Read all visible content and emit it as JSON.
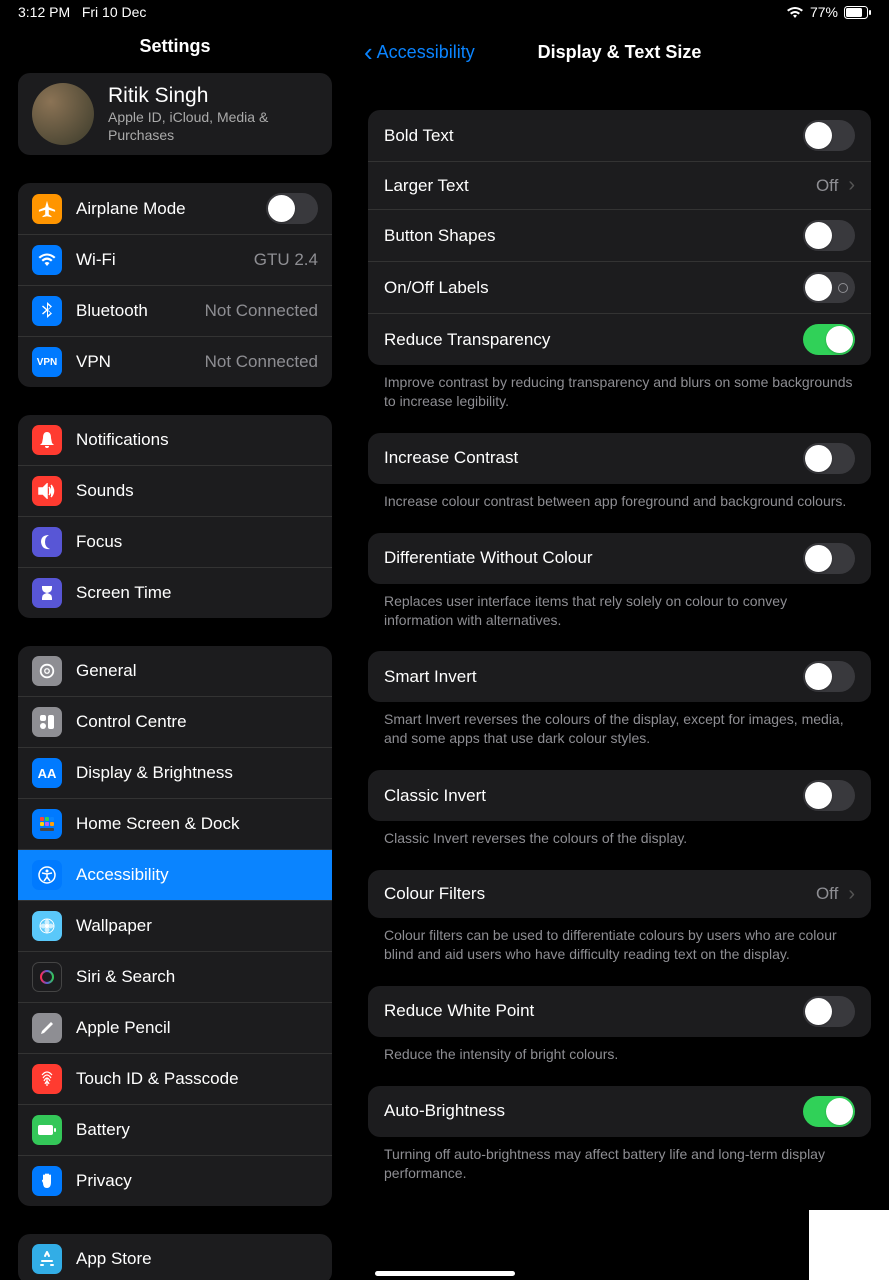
{
  "status": {
    "time": "3:12 PM",
    "date": "Fri 10 Dec",
    "battery": "77%"
  },
  "sidebar": {
    "title": "Settings",
    "profile": {
      "name": "Ritik Singh",
      "sub": "Apple ID, iCloud, Media & Purchases"
    },
    "g1": {
      "airplane": "Airplane Mode",
      "wifi": "Wi-Fi",
      "wifi_val": "GTU 2.4",
      "bluetooth": "Bluetooth",
      "bluetooth_val": "Not Connected",
      "vpn": "VPN",
      "vpn_val": "Not Connected"
    },
    "g2": {
      "notifications": "Notifications",
      "sounds": "Sounds",
      "focus": "Focus",
      "screentime": "Screen Time"
    },
    "g3": {
      "general": "General",
      "control": "Control Centre",
      "display": "Display & Brightness",
      "home": "Home Screen & Dock",
      "accessibility": "Accessibility",
      "wallpaper": "Wallpaper",
      "siri": "Siri & Search",
      "pencil": "Apple Pencil",
      "touchid": "Touch ID & Passcode",
      "battery": "Battery",
      "privacy": "Privacy"
    },
    "g4": {
      "appstore": "App Store"
    }
  },
  "detail": {
    "back": "Accessibility",
    "title": "Display & Text Size",
    "s1": {
      "bold": "Bold Text",
      "larger": "Larger Text",
      "larger_val": "Off",
      "shapes": "Button Shapes",
      "onoff": "On/Off Labels",
      "transparency": "Reduce Transparency",
      "transparency_foot": "Improve contrast by reducing transparency and blurs on some backgrounds to increase legibility."
    },
    "s2": {
      "contrast": "Increase Contrast",
      "contrast_foot": "Increase colour contrast between app foreground and background colours."
    },
    "s3": {
      "diff": "Differentiate Without Colour",
      "diff_foot": "Replaces user interface items that rely solely on colour to convey information with alternatives."
    },
    "s4": {
      "smart": "Smart Invert",
      "smart_foot": "Smart Invert reverses the colours of the display, except for images, media, and some apps that use dark colour styles."
    },
    "s5": {
      "classic": "Classic Invert",
      "classic_foot": "Classic Invert reverses the colours of the display."
    },
    "s6": {
      "filters": "Colour Filters",
      "filters_val": "Off",
      "filters_foot": "Colour filters can be used to differentiate colours by users who are colour blind and aid users who have difficulty reading text on the display."
    },
    "s7": {
      "white": "Reduce White Point",
      "white_foot": "Reduce the intensity of bright colours."
    },
    "s8": {
      "auto": "Auto-Brightness",
      "auto_foot": "Turning off auto-brightness may affect battery life and long-term display performance."
    }
  }
}
